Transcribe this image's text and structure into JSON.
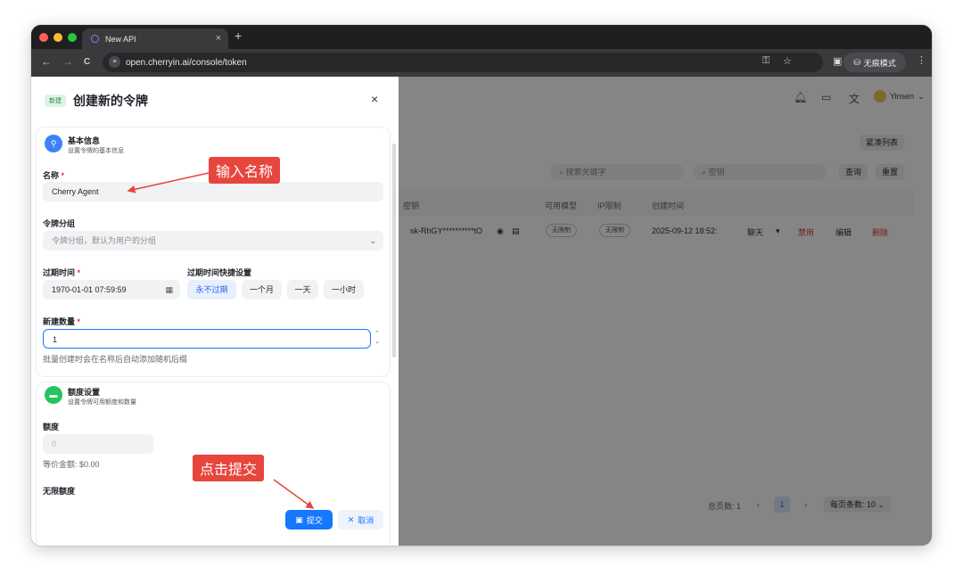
{
  "browser": {
    "tab_title": "New API",
    "tab_close": "×",
    "new_tab": "+",
    "back": "←",
    "forward": "→",
    "reload": "C",
    "url": "open.cherryin.ai/console/token",
    "incognito_label": "无痕模式",
    "menu": "⋮"
  },
  "background_page": {
    "compact_list_button": "紧凑列表",
    "search_keyword_placeholder": "搜索关键字",
    "search_key_placeholder": "密钥",
    "query_button": "查询",
    "reset_button": "重置",
    "columns": [
      "密钥",
      "可用模型",
      "IP限制",
      "创建时间"
    ],
    "row": {
      "key": "sk-RhGY**********tO",
      "models": "无限制",
      "ip": "无限制",
      "created": "2025-09-12 18:52:",
      "chat": "聊天",
      "disable": "禁用",
      "edit": "编辑",
      "delete": "删除"
    },
    "user_name": "Yinsen",
    "total_pages": "总页数: 1",
    "current_page": "1",
    "page_size": "每页条数: 10"
  },
  "drawer": {
    "tag": "新建",
    "title": "创建新的令牌",
    "close": "×",
    "basic": {
      "title": "基本信息",
      "subtitle": "设置令牌的基本信息",
      "name_label": "名称",
      "name_value": "Cherry Agent",
      "group_label": "令牌分组",
      "group_placeholder": "令牌分组，默认为用户的分组",
      "expire_label": "过期时间",
      "expire_value": "1970-01-01 07:59:59",
      "quick_label": "过期时间快捷设置",
      "quick_options": [
        "永不过期",
        "一个月",
        "一天",
        "一小时"
      ],
      "count_label": "新建数量",
      "count_value": "1",
      "count_help": "批量创建时会在名称后自动添加随机后缀"
    },
    "quota": {
      "title": "额度设置",
      "subtitle": "设置令牌可用额度和数量",
      "quota_label": "额度",
      "quota_placeholder": "0",
      "equivalent": "等价金额: $0.00",
      "unlimited_label": "无限额度"
    },
    "submit": "提交",
    "cancel": "取消",
    "required_mark": "*"
  },
  "annotations": {
    "name_callout": "输入名称",
    "submit_callout": "点击提交"
  },
  "colors": {
    "accent": "#1677ff",
    "callout": "#e8453c",
    "danger": "#e53935"
  }
}
